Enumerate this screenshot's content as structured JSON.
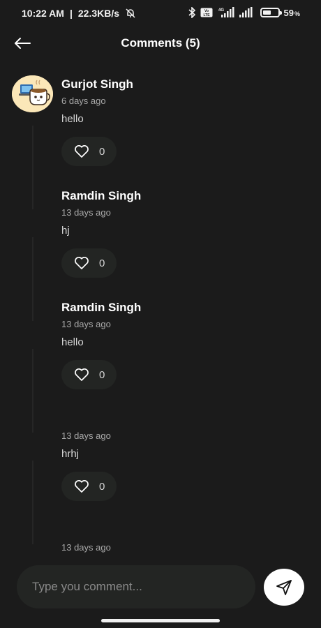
{
  "status_bar": {
    "time": "10:22 AM",
    "separator": "|",
    "speed": "22.3KB/s",
    "network": "4G",
    "volte": "Vo LTE",
    "battery_percent": "59",
    "battery_sign": "%",
    "battery_level": 0.59,
    "icons": [
      "bell-off-icon",
      "bluetooth-icon",
      "volte-icon",
      "signal-icon",
      "signal-icon",
      "battery-icon"
    ]
  },
  "header": {
    "back_icon": "arrow-left-icon",
    "title": "Comments (5)"
  },
  "comments": [
    {
      "author": "Gurjot Singh",
      "time": "6 days ago",
      "text": "hello",
      "likes": "0",
      "has_avatar": true
    },
    {
      "author": "Ramdin Singh",
      "time": "13 days ago",
      "text": "hj",
      "likes": "0"
    },
    {
      "author": "Ramdin Singh",
      "time": "13 days ago",
      "text": "hello",
      "likes": "0"
    },
    {
      "author": "",
      "time": "13 days ago",
      "text": "hrhj",
      "likes": "0"
    },
    {
      "author": "",
      "time": "13 days ago",
      "text": "",
      "likes": ""
    }
  ],
  "composer": {
    "placeholder": "Type you comment...",
    "send_icon": "send-icon"
  },
  "colors": {
    "background": "#1b1b1b",
    "pill": "#232523",
    "avatar_bg": "#fbe7b8",
    "muted_text": "#a8a8a8"
  }
}
